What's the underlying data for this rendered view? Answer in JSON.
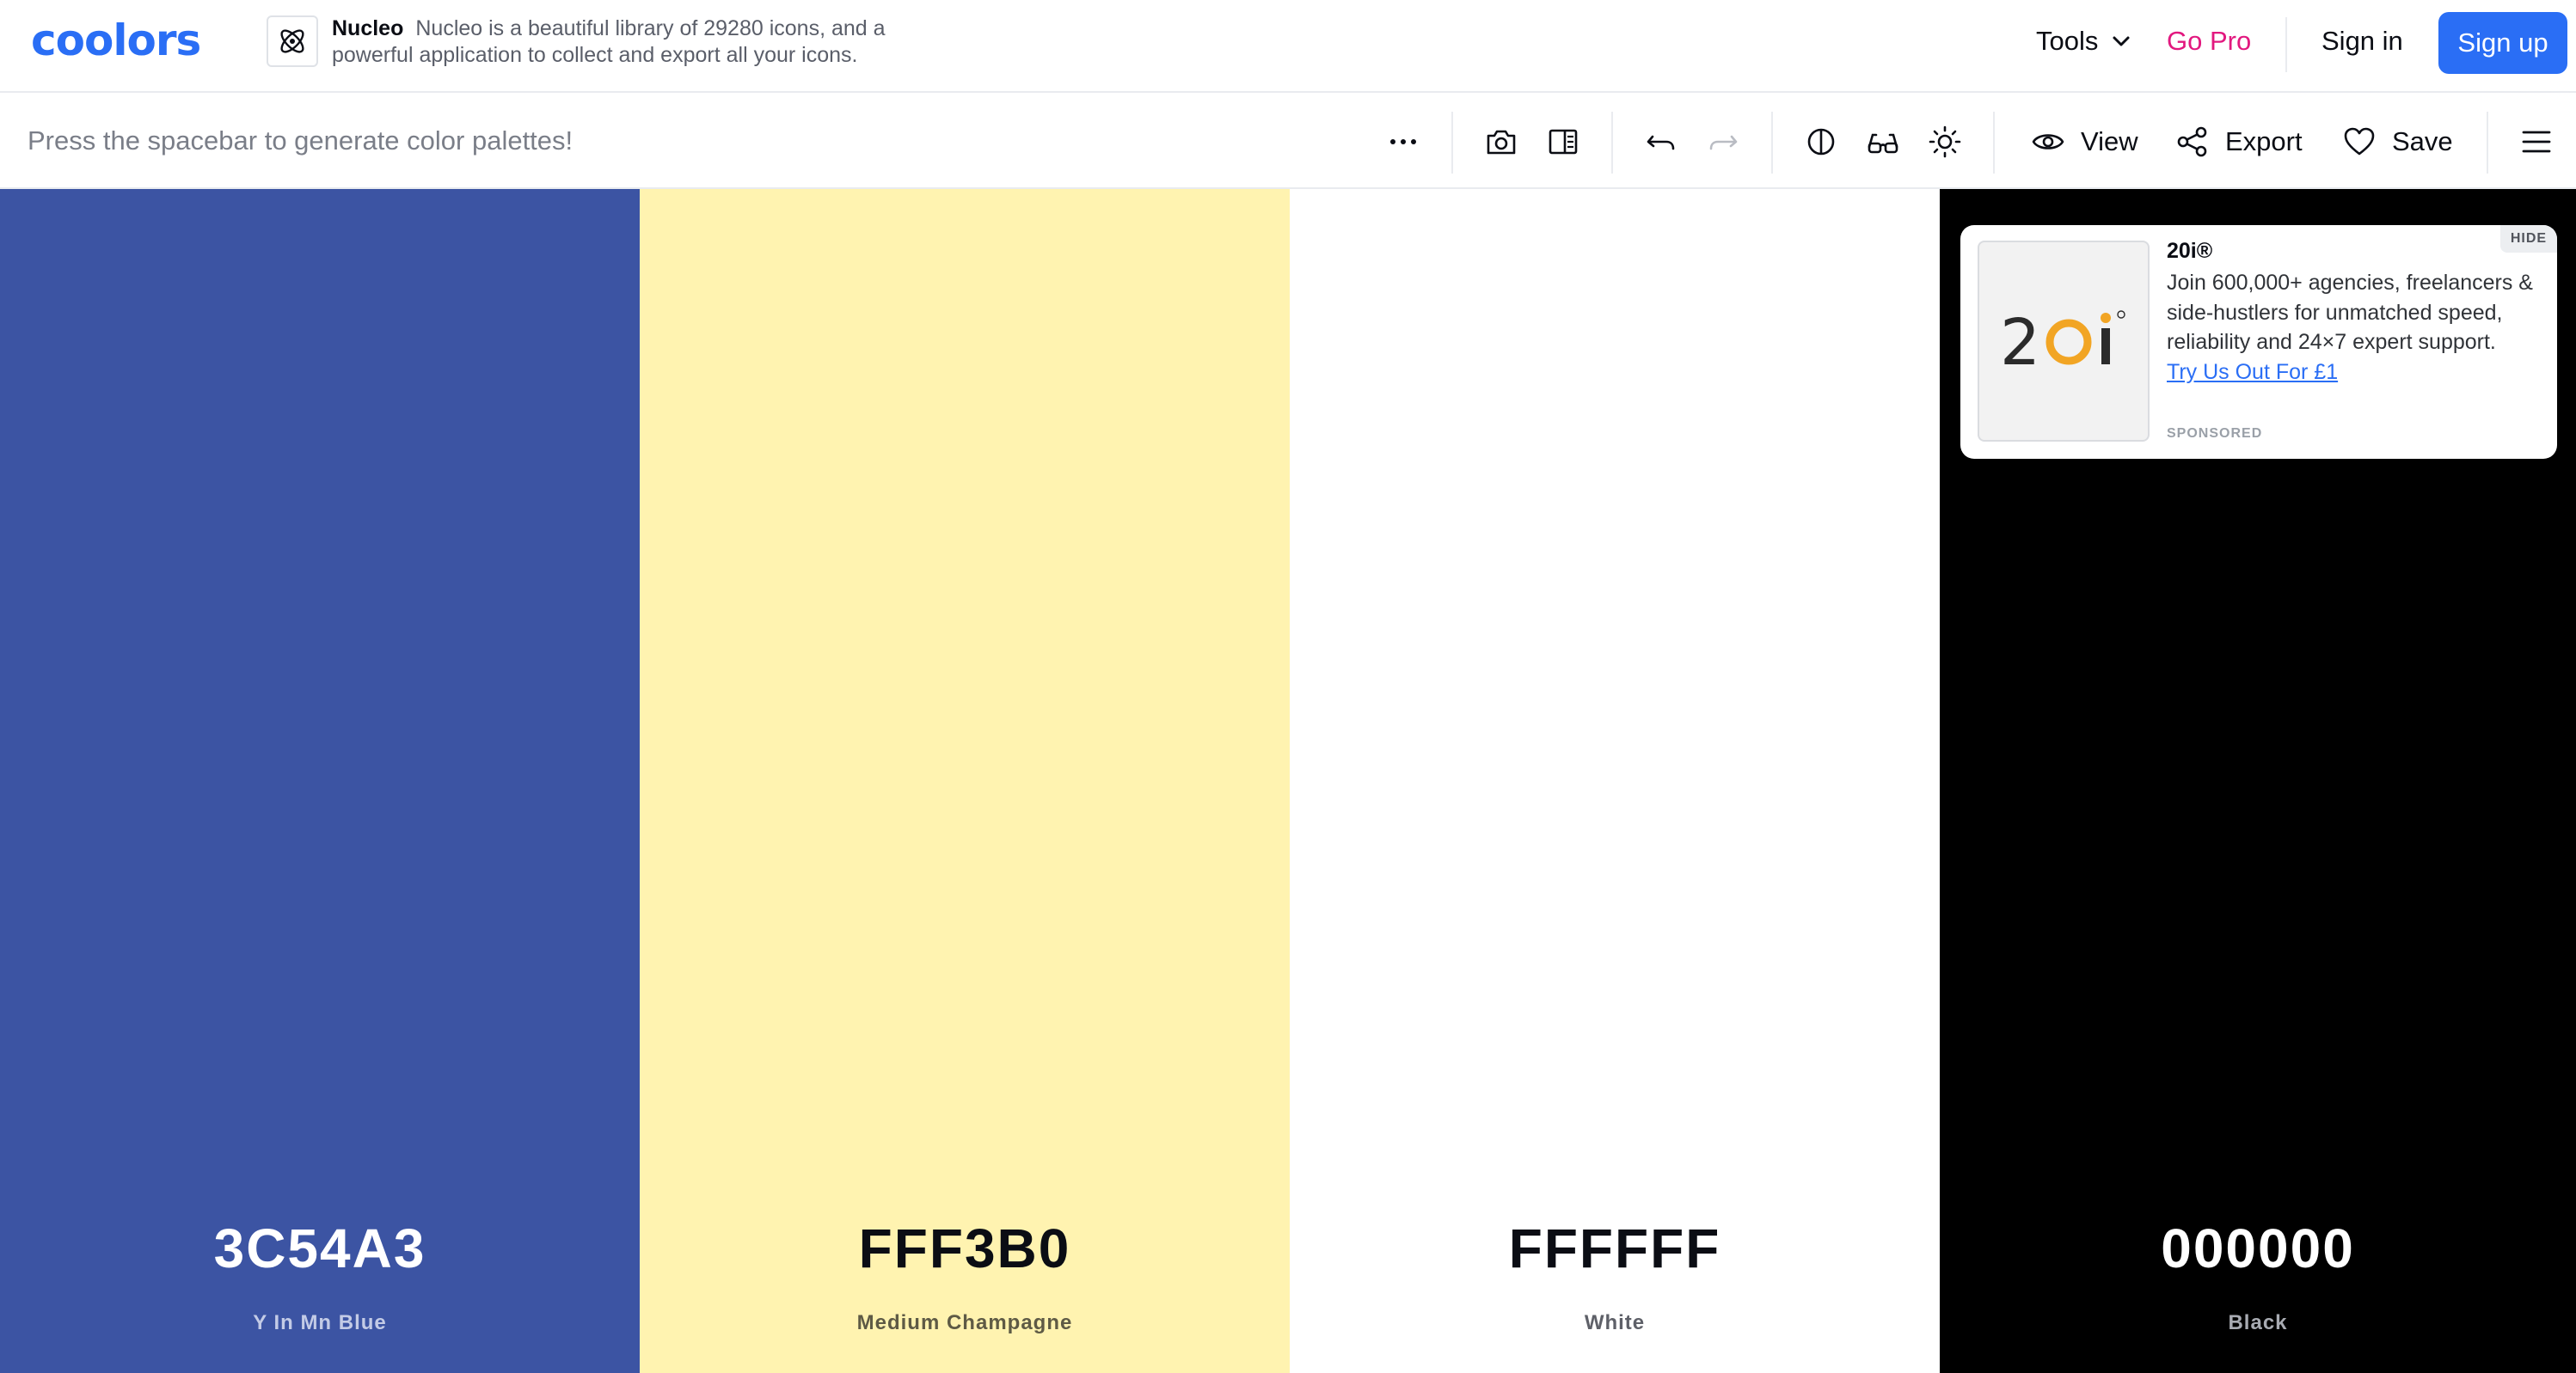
{
  "header": {
    "logo_text": "coolors",
    "nucleo": {
      "name": "Nucleo",
      "description": "Nucleo is a beautiful library of 29280 icons, and a powerful application to collect and export all your icons."
    },
    "tools_label": "Tools",
    "gopro_label": "Go Pro",
    "signin_label": "Sign in",
    "signup_label": "Sign up"
  },
  "toolbar": {
    "hint": "Press the spacebar to generate color palettes!",
    "view_label": "View",
    "export_label": "Export",
    "save_label": "Save",
    "icons": [
      "more-icon",
      "camera-icon",
      "panel-icon",
      "undo-icon",
      "redo-icon",
      "contrast-icon",
      "glasses-icon",
      "sun-icon",
      "eye-icon",
      "share-icon",
      "heart-icon",
      "menu-icon"
    ]
  },
  "palette": [
    {
      "hex": "3C54A3",
      "name": "Y In Mn Blue",
      "color": "#3C54A3",
      "text_color": "#ffffff",
      "name_color": "#c3cbe6"
    },
    {
      "hex": "FFF3B0",
      "name": "Medium Champagne",
      "color": "#FFF3B0",
      "text_color": "#0b0d14",
      "name_color": "#5e5a45"
    },
    {
      "hex": "FFFFFF",
      "name": "White",
      "color": "#FFFFFF",
      "text_color": "#0b0d14",
      "name_color": "#5e6068"
    },
    {
      "hex": "000000",
      "name": "Black",
      "color": "#000000",
      "text_color": "#ffffff",
      "name_color": "#a8abb2"
    }
  ],
  "ad": {
    "hide_label": "HIDE",
    "logo_text": "20i",
    "title": "20i®",
    "body": "Join 600,000+ agencies, freelancers & side-hustlers for unmatched speed, reliability and 24×7 expert support.",
    "link_text": "Try Us Out For £1",
    "sponsored_label": "SPONSORED"
  },
  "colors": {
    "brand_blue": "#2a6ef5",
    "gopro_pink": "#e2187f"
  }
}
